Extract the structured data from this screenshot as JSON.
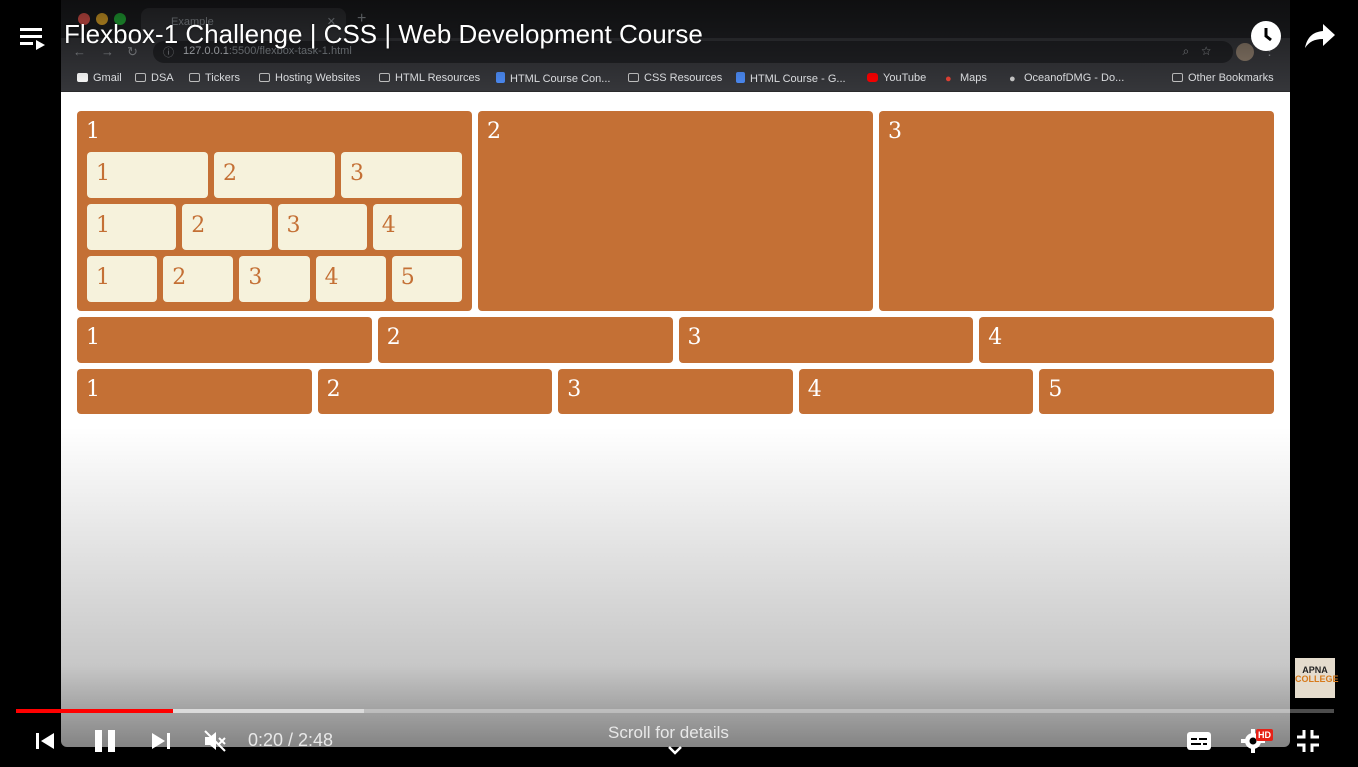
{
  "video": {
    "title": "Flexbox-1 Challenge | CSS | Web Development Course",
    "current_time": "0:20",
    "duration": "2:48",
    "time_display": "0:20 / 2:48",
    "played_fraction": 0.119,
    "loaded_fraction": 0.264,
    "scroll_hint": "Scroll for details",
    "hd_badge": "HD",
    "watermark_line1": "APNA",
    "watermark_line2": "COLLEGE"
  },
  "browser": {
    "tab_title": "Example",
    "url_host": "127.0.0.1",
    "url_path": ":5500/flexbox-task-1.html",
    "bookmarks": [
      {
        "label": "Gmail",
        "icon": "gmail-icon"
      },
      {
        "label": "DSA",
        "icon": "folder-icon"
      },
      {
        "label": "Tickers",
        "icon": "folder-icon"
      },
      {
        "label": "Hosting Websites",
        "icon": "folder-icon"
      },
      {
        "label": "HTML Resources",
        "icon": "folder-icon"
      },
      {
        "label": "HTML Course Con...",
        "icon": "doc-icon"
      },
      {
        "label": "CSS Resources",
        "icon": "folder-icon"
      },
      {
        "label": "HTML Course - G...",
        "icon": "doc-icon"
      },
      {
        "label": "YouTube",
        "icon": "youtube-icon"
      },
      {
        "label": "Maps",
        "icon": "maps-icon"
      },
      {
        "label": "OceanofDMG - Do...",
        "icon": "apple-icon"
      },
      {
        "label": "Other Bookmarks",
        "icon": "folder-icon"
      }
    ]
  },
  "page": {
    "colors": {
      "box": "#c47035",
      "inner": "#f6f2dc"
    },
    "row1": {
      "boxes": [
        "1",
        "2",
        "3"
      ],
      "nested_rows": [
        [
          "1",
          "2",
          "3"
        ],
        [
          "1",
          "2",
          "3",
          "4"
        ],
        [
          "1",
          "2",
          "3",
          "4",
          "5"
        ]
      ]
    },
    "row2": [
      "1",
      "2",
      "3",
      "4"
    ],
    "row3": [
      "1",
      "2",
      "3",
      "4",
      "5"
    ]
  }
}
